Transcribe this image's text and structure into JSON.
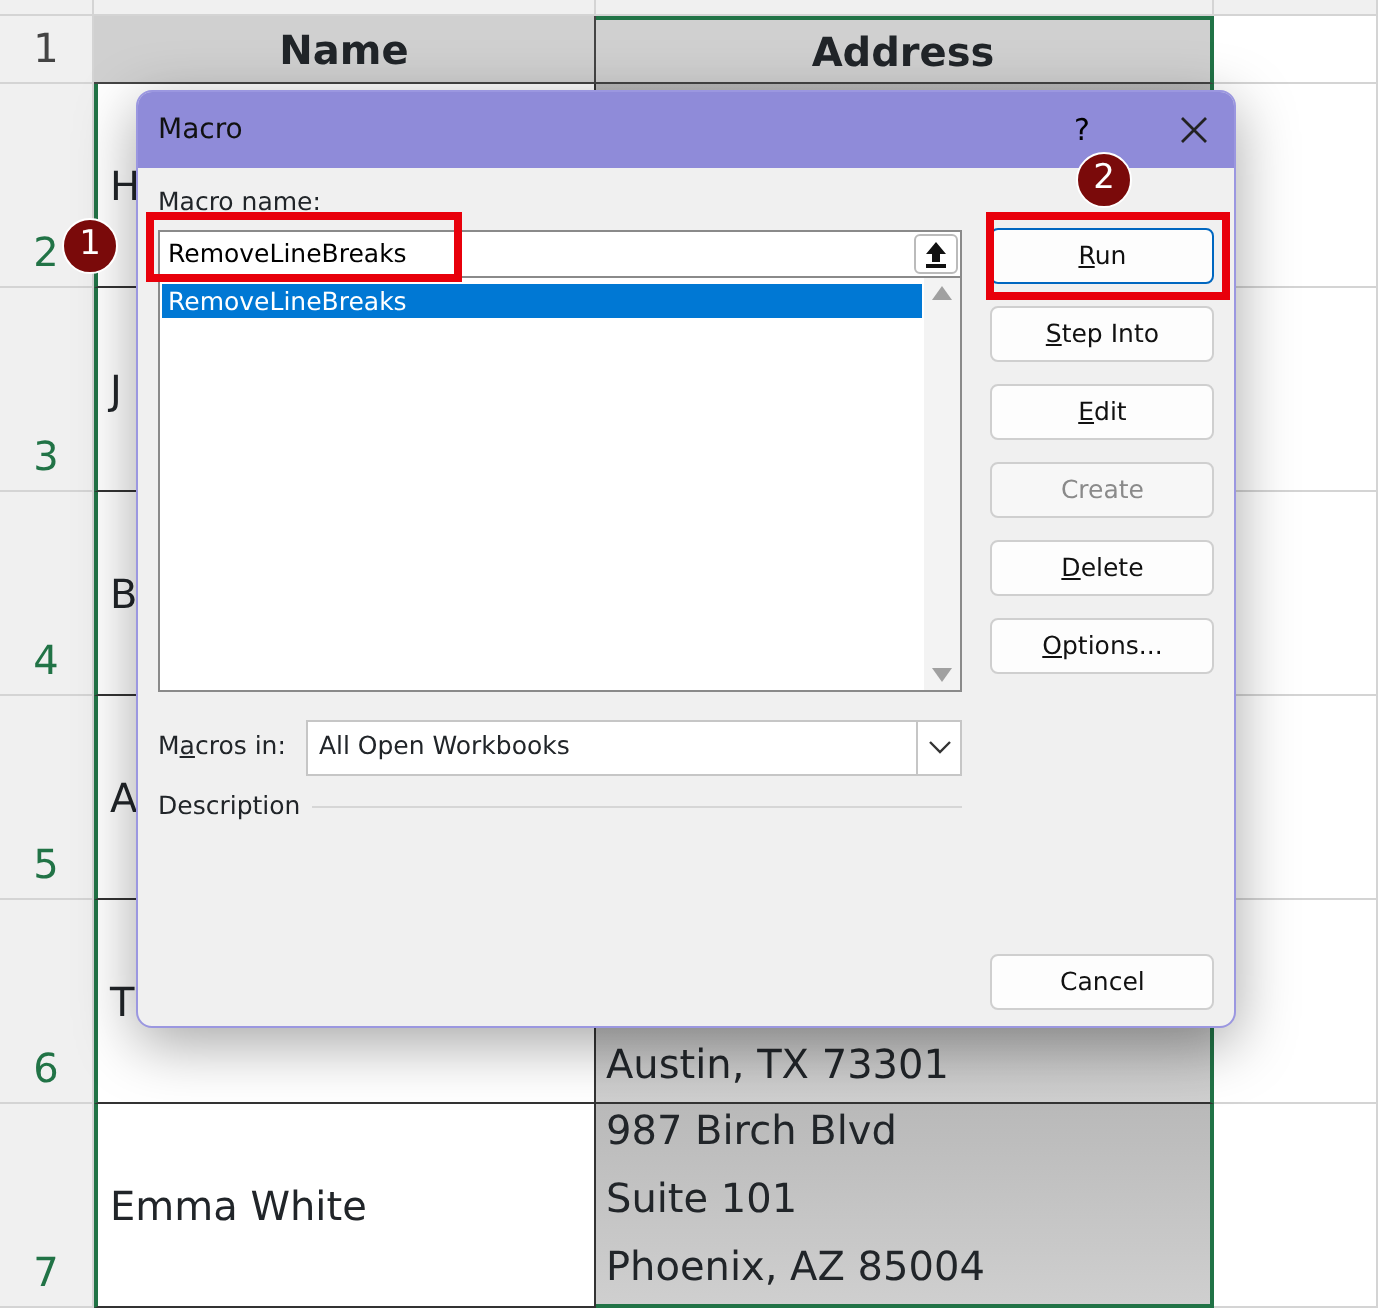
{
  "sheet": {
    "columns": [
      "Name",
      "Address"
    ],
    "rows": [
      {
        "number": "1",
        "kind": "header"
      },
      {
        "number": "2",
        "name": "H",
        "address": []
      },
      {
        "number": "3",
        "name": "J",
        "address": []
      },
      {
        "number": "4",
        "name": "B",
        "address": []
      },
      {
        "number": "5",
        "name": "A",
        "address": []
      },
      {
        "number": "6",
        "name": "T",
        "address": [
          "Austin, TX 73301"
        ]
      },
      {
        "number": "7",
        "name": "Emma White",
        "address": [
          "987 Birch Blvd",
          "Suite 101",
          "Phoenix, AZ 85004"
        ]
      }
    ]
  },
  "dialog": {
    "title": "Macro",
    "help": "?",
    "macro_name_label": "Macro name:",
    "macro_name_value": "RemoveLineBreaks",
    "macros": [
      {
        "label": "RemoveLineBreaks",
        "selected": true
      }
    ],
    "macros_in_label": [
      {
        "text": "M",
        "underlined": false
      },
      {
        "text": "a",
        "underlined": true
      },
      {
        "text": "cros in:",
        "underlined": false
      }
    ],
    "macros_in_value": "All Open Workbooks",
    "description_label": "Description",
    "buttons": [
      {
        "label": [
          {
            "text": "R",
            "underlined": true
          },
          {
            "text": "un",
            "underlined": false
          }
        ],
        "disabled": false,
        "highlighted": true
      },
      {
        "label": [
          {
            "text": "S",
            "underlined": true
          },
          {
            "text": "tep Into",
            "underlined": false
          }
        ],
        "disabled": false,
        "highlighted": false
      },
      {
        "label": [
          {
            "text": "E",
            "underlined": true
          },
          {
            "text": "dit",
            "underlined": false
          }
        ],
        "disabled": false,
        "highlighted": false
      },
      {
        "label": [
          {
            "text": "Create",
            "underlined": false
          }
        ],
        "disabled": true,
        "highlighted": false
      },
      {
        "label": [
          {
            "text": "D",
            "underlined": true
          },
          {
            "text": "elete",
            "underlined": false
          }
        ],
        "disabled": false,
        "highlighted": false
      },
      {
        "label": [
          {
            "text": "O",
            "underlined": true
          },
          {
            "text": "ptions...",
            "underlined": false
          }
        ],
        "disabled": false,
        "highlighted": false
      }
    ],
    "cancel": "Cancel"
  },
  "callouts": [
    {
      "number": "1"
    },
    {
      "number": "2"
    }
  ]
}
